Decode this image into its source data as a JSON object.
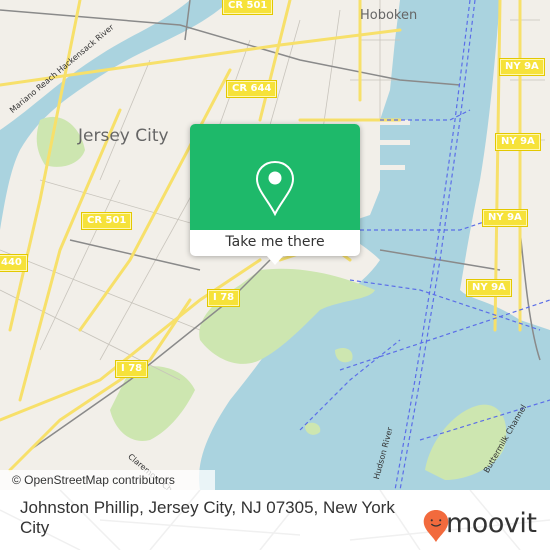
{
  "map": {
    "place_labels": {
      "jersey_city": "Jersey City",
      "hoboken": "Hoboken"
    },
    "water_labels": {
      "hackensack": "Mariano Reach Hackensack River",
      "hudson": "Hudson River",
      "claremont": "Claremont Channel",
      "buttermilk": "Buttermilk Channel"
    },
    "shields": {
      "cr501_top": "CR 501",
      "cr644": "CR 644",
      "cr501_mid": "CR 501",
      "r440": "440",
      "i78_a": "I 78",
      "i78_b": "I 78",
      "ny9a_a": "NY 9A",
      "ny9a_b": "NY 9A",
      "ny9a_c": "NY 9A",
      "ny9a_d": "NY 9A"
    },
    "attribution": "© OpenStreetMap contributors",
    "colors": {
      "land": "#f2efe9",
      "water": "#aad3df",
      "park": "#cde6b0",
      "road": "#f7e06a",
      "ferry": "#5b6ee8",
      "rail": "#8a8a8a"
    }
  },
  "popup": {
    "icon": "map-pin-icon",
    "button_label": "Take me there",
    "color": "#1eb96a"
  },
  "footer": {
    "address": "Johnston Phillip, Jersey City, NJ 07305, New York City",
    "brand": "moovit",
    "brand_color": "#f26a3d"
  }
}
